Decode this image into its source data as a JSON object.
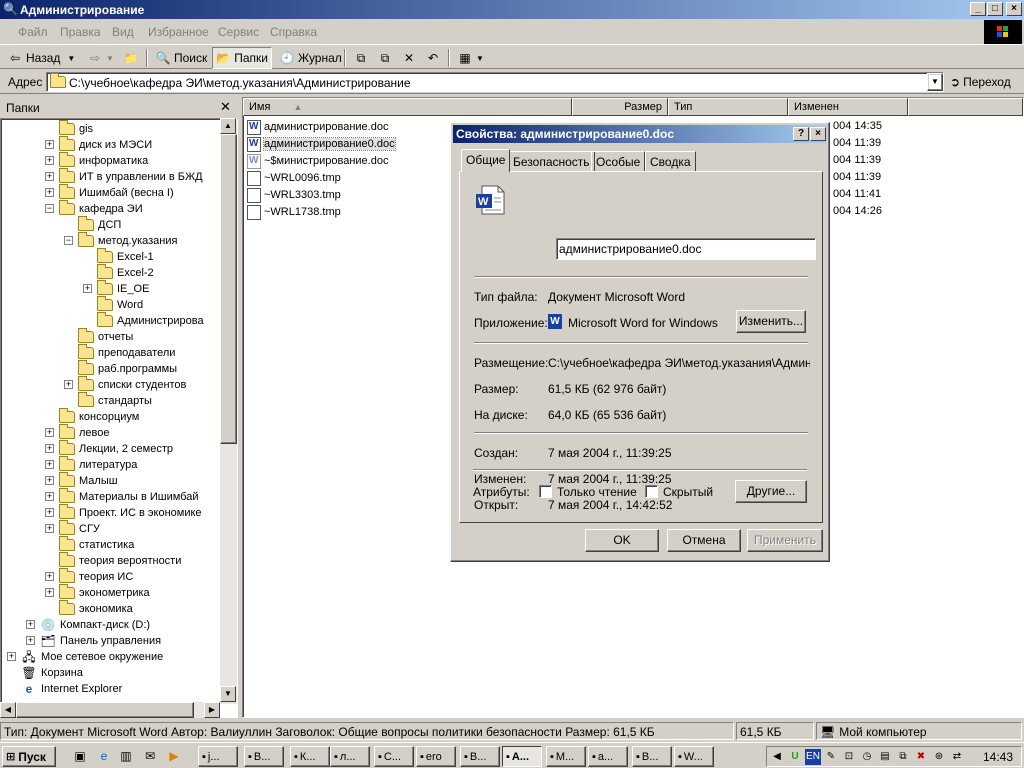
{
  "window": {
    "title": "Администрирование",
    "controls": {
      "minimize": "_",
      "maximize": "□",
      "close": "×"
    }
  },
  "menu": [
    "Файл",
    "Правка",
    "Вид",
    "Избранное",
    "Сервис",
    "Справка"
  ],
  "toolbar": {
    "back": "Назад",
    "search": "Поиск",
    "folders": "Папки",
    "history": "Журнал"
  },
  "address": {
    "label": "Адрес",
    "value": "C:\\учебное\\кафедра ЭИ\\метод.указания\\Администрирование",
    "go": "Переход"
  },
  "folders_pane": {
    "title": "Папки",
    "items": [
      {
        "label": "gis",
        "level": 3,
        "expander": ""
      },
      {
        "label": "диск из МЭСИ",
        "level": 3,
        "expander": "+"
      },
      {
        "label": "информатика",
        "level": 3,
        "expander": "+"
      },
      {
        "label": "ИТ в управлении в БЖД",
        "level": 3,
        "expander": "+"
      },
      {
        "label": "Ишимбай (весна I)",
        "level": 3,
        "expander": "+"
      },
      {
        "label": "кафедра ЭИ",
        "level": 3,
        "expander": "-"
      },
      {
        "label": "ДСП",
        "level": 4,
        "expander": ""
      },
      {
        "label": "метод.указания",
        "level": 4,
        "expander": "-"
      },
      {
        "label": "Excel-1",
        "level": 5,
        "expander": ""
      },
      {
        "label": "Excel-2",
        "level": 5,
        "expander": ""
      },
      {
        "label": "IE_OE",
        "level": 5,
        "expander": "+"
      },
      {
        "label": "Word",
        "level": 5,
        "expander": ""
      },
      {
        "label": "Администрирова",
        "level": 5,
        "expander": ""
      },
      {
        "label": "отчеты",
        "level": 4,
        "expander": ""
      },
      {
        "label": "преподаватели",
        "level": 4,
        "expander": ""
      },
      {
        "label": "раб.программы",
        "level": 4,
        "expander": ""
      },
      {
        "label": "списки студентов",
        "level": 4,
        "expander": "+"
      },
      {
        "label": "стандарты",
        "level": 4,
        "expander": ""
      },
      {
        "label": "консорциум",
        "level": 3,
        "expander": ""
      },
      {
        "label": "левое",
        "level": 3,
        "expander": "+"
      },
      {
        "label": "Лекции, 2 семестр",
        "level": 3,
        "expander": "+"
      },
      {
        "label": "литература",
        "level": 3,
        "expander": "+"
      },
      {
        "label": "Малыш",
        "level": 3,
        "expander": "+"
      },
      {
        "label": "Материалы в Ишимбай",
        "level": 3,
        "expander": "+"
      },
      {
        "label": "Проект. ИС в экономике",
        "level": 3,
        "expander": "+"
      },
      {
        "label": "СГУ",
        "level": 3,
        "expander": "+"
      },
      {
        "label": "статистика",
        "level": 3,
        "expander": ""
      },
      {
        "label": "теория вероятности",
        "level": 3,
        "expander": ""
      },
      {
        "label": "теория ИС",
        "level": 3,
        "expander": "+"
      },
      {
        "label": "эконометрика",
        "level": 3,
        "expander": "+"
      },
      {
        "label": "экономика",
        "level": 3,
        "expander": ""
      },
      {
        "label": "Компакт-диск (D:)",
        "level": 2,
        "expander": "+",
        "icon": "cd"
      },
      {
        "label": "Панель управления",
        "level": 2,
        "expander": "+",
        "icon": "panel"
      },
      {
        "label": "Мое сетевое окружение",
        "level": 1,
        "expander": "+",
        "icon": "network"
      },
      {
        "label": "Корзина",
        "level": 1,
        "expander": "",
        "icon": "trash"
      },
      {
        "label": "Internet Explorer",
        "level": 1,
        "expander": "",
        "icon": "ie"
      }
    ]
  },
  "file_list": {
    "columns": [
      "Имя",
      "Размер",
      "Тип",
      "Изменен"
    ],
    "files": [
      {
        "name": "администрирование.doc",
        "icon": "word",
        "modified": "004 14:35"
      },
      {
        "name": "администрирование0.doc",
        "icon": "word",
        "modified": "004 11:39",
        "selected": true
      },
      {
        "name": "~$министрирование.doc",
        "icon": "word-temp",
        "modified": "004 11:39"
      },
      {
        "name": "~WRL0096.tmp",
        "icon": "tmp",
        "modified": "004 11:39"
      },
      {
        "name": "~WRL3303.tmp",
        "icon": "tmp",
        "modified": "004 11:41"
      },
      {
        "name": "~WRL1738.tmp",
        "icon": "tmp",
        "modified": "004 14:26"
      }
    ]
  },
  "dialog": {
    "title": "Свойства: администрирование0.doc",
    "tabs": [
      "Общие",
      "Безопасность",
      "Особые",
      "Сводка"
    ],
    "active_tab": "Общие",
    "file_name": "администрирование0.doc",
    "rows": {
      "type_label": "Тип файла:",
      "type_value": "Документ Microsoft Word",
      "app_label": "Приложение:",
      "app_value": "Microsoft Word for Windows",
      "change_btn": "Изменить...",
      "location_label": "Размещение:",
      "location_value": "C:\\учебное\\кафедра ЭИ\\метод.указания\\Админист",
      "size_label": "Размер:",
      "size_value": "61,5 КБ (62 976 байт)",
      "disk_label": "На диске:",
      "disk_value": "64,0 КБ (65 536 байт)",
      "created_label": "Создан:",
      "created_value": "7 мая 2004 г., 11:39:25",
      "modified_label": "Изменен:",
      "modified_value": "7 мая 2004 г., 11:39:25",
      "opened_label": "Открыт:",
      "opened_value": "7 мая 2004 г., 14:42:52",
      "attr_label": "Атрибуты:",
      "readonly": "Только чтение",
      "hidden": "Скрытый",
      "other_btn": "Другие..."
    },
    "buttons": {
      "ok": "OK",
      "cancel": "Отмена",
      "apply": "Применить"
    }
  },
  "status": {
    "info": "Тип: Документ Microsoft Word Автор: Валиуллин Заговолок: Общие вопросы политики безопасности Размер: 61,5 КБ",
    "size": "61,5 КБ",
    "zone": "Мой компьютер"
  },
  "taskbar": {
    "start": "Пуск",
    "tasks": [
      "j...",
      "В...",
      "К...",
      "л...",
      "С...",
      "ero",
      "В...",
      "А...",
      "М...",
      "а...",
      "В...",
      "W..."
    ],
    "active_task": "А...",
    "lang": "EN",
    "clock": "14:43"
  }
}
